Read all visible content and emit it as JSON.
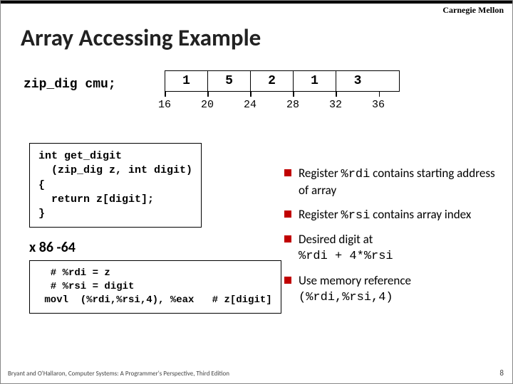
{
  "header": {
    "institution": "Carnegie Mellon",
    "title": "Array Accessing Example"
  },
  "decl": "zip_dig cmu;",
  "array": {
    "cells": [
      "1",
      "5",
      "2",
      "1",
      "3"
    ],
    "addresses": [
      "16",
      "20",
      "24",
      "28",
      "32",
      "36"
    ]
  },
  "code1": "int get_digit\n  (zip_dig z, int digit)\n{\n  return z[digit];\n}",
  "arch_label": "x 86 -64",
  "code2": "  # %rdi = z\n  # %rsi = digit\n movl  (%rdi,%rsi,4), %eax   # z[digit]",
  "bullets": {
    "b0a": "Register ",
    "b0m": "%rdi",
    "b0b": " contains starting address of array",
    "b1a": "Register ",
    "b1m": "%rsi",
    "b1b": " contains array index",
    "b2a": "Desired digit at ",
    "b2m": "%rdi + 4*%rsi",
    "b3a": "Use memory reference ",
    "b3m": "(%rdi,%rsi,4)"
  },
  "footer": {
    "text": "Bryant and O'Hallaron, Computer Systems: A Programmer's Perspective, Third Edition",
    "page": "8"
  }
}
